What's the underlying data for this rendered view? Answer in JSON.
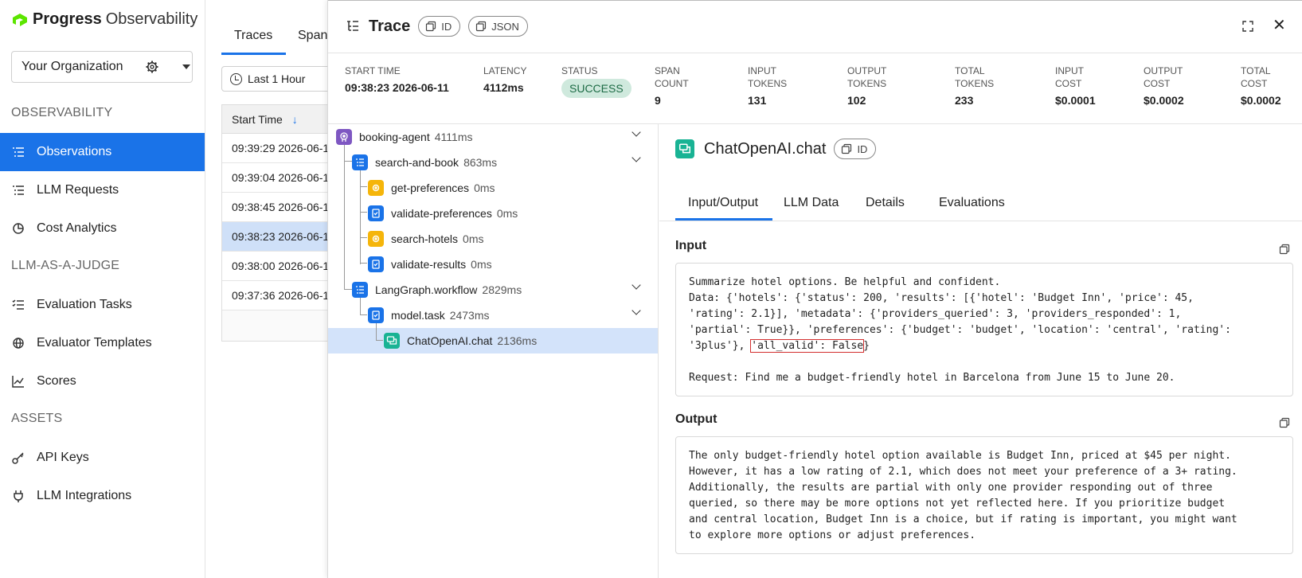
{
  "brand": {
    "name_bold": "Progress",
    "name_light": "Observability"
  },
  "org": {
    "label": "Your Organization"
  },
  "sidebar": {
    "sections": [
      "OBSERVABILITY",
      "LLM-AS-A-JUDGE",
      "ASSETS"
    ],
    "items": [
      {
        "label": "Observations",
        "icon": "list-icon"
      },
      {
        "label": "LLM Requests",
        "icon": "list-icon"
      },
      {
        "label": "Cost Analytics",
        "icon": "pie-chart-icon"
      },
      {
        "label": "Evaluation Tasks",
        "icon": "checklist-icon"
      },
      {
        "label": "Evaluator Templates",
        "icon": "globe-icon"
      },
      {
        "label": "Scores",
        "icon": "line-chart-icon"
      },
      {
        "label": "API Keys",
        "icon": "key-icon"
      },
      {
        "label": "LLM Integrations",
        "icon": "plug-icon"
      }
    ]
  },
  "list": {
    "tabs": [
      "Traces",
      "Span"
    ],
    "time_filter": "Last 1 Hour",
    "column_header": "Start Time",
    "rows": [
      "09:39:29 2026-06-1",
      "09:39:04 2026-06-1",
      "09:38:45 2026-06-1",
      "09:38:23 2026-06-1",
      "09:38:00 2026-06-1",
      "09:37:36 2026-06-1"
    ]
  },
  "trace": {
    "title": "Trace",
    "chips": [
      "ID",
      "JSON"
    ],
    "stats": [
      {
        "label": "START TIME",
        "value": "09:38:23 2026-06-11"
      },
      {
        "label": "LATENCY",
        "value": "4112ms"
      },
      {
        "label": "STATUS",
        "value": "Success"
      },
      {
        "label_1": "SPAN",
        "label_2": "COUNT",
        "value": "9"
      },
      {
        "label_1": "INPUT",
        "label_2": "TOKENS",
        "value": "131"
      },
      {
        "label_1": "OUTPUT",
        "label_2": "TOKENS",
        "value": "102"
      },
      {
        "label_1": "TOTAL",
        "label_2": "TOKENS",
        "value": "233"
      },
      {
        "label_1": "INPUT",
        "label_2": "COST",
        "value": "$0.0001"
      },
      {
        "label_1": "OUTPUT",
        "label_2": "COST",
        "value": "$0.0002"
      },
      {
        "label_1": "TOTAL",
        "label_2": "COST",
        "value": "$0.0002"
      }
    ],
    "status_color": "#cfe9dd"
  },
  "tree": [
    {
      "name": "booking-agent",
      "duration": "4111ms",
      "icon": "agent-icon",
      "color": "#7e57c2"
    },
    {
      "name": "search-and-book",
      "duration": "863ms",
      "icon": "workflow-icon",
      "color": "#1a73e8"
    },
    {
      "name": "get-preferences",
      "duration": "0ms",
      "icon": "tool-icon",
      "color": "#f5b50a"
    },
    {
      "name": "validate-preferences",
      "duration": "0ms",
      "icon": "task-icon",
      "color": "#1a73e8"
    },
    {
      "name": "search-hotels",
      "duration": "0ms",
      "icon": "tool-icon",
      "color": "#f5b50a"
    },
    {
      "name": "validate-results",
      "duration": "0ms",
      "icon": "task-icon",
      "color": "#1a73e8"
    },
    {
      "name": "LangGraph.workflow",
      "duration": "2829ms",
      "icon": "workflow-icon",
      "color": "#1a73e8"
    },
    {
      "name": "model.task",
      "duration": "2473ms",
      "icon": "task-icon",
      "color": "#1a73e8"
    },
    {
      "name": "ChatOpenAI.chat",
      "duration": "2136ms",
      "icon": "chat-icon",
      "color": "#19b394"
    }
  ],
  "detail": {
    "title": "ChatOpenAI.chat",
    "chip": "ID",
    "tabs": [
      "Input/Output",
      "LLM Data",
      "Details",
      "Evaluations"
    ],
    "input_label": "Input",
    "input_pre": "Summarize hotel options. Be helpful and confident.\nData: {'hotels': {'status': 200, 'results': [{'hotel': 'Budget Inn', 'price': 45,\n'rating': 2.1}], 'metadata': {'providers_queried': 3, 'providers_responded': 1,\n'partial': True}}, 'preferences': {'budget': 'budget', 'location': 'central', 'rating':\n'3plus'}, ",
    "input_highlight": "'all_valid': False",
    "input_post": "}\n\nRequest: Find me a budget-friendly hotel in Barcelona from June 15 to June 20.",
    "output_label": "Output",
    "output_text": "The only budget-friendly hotel option available is Budget Inn, priced at $45 per night.\nHowever, it has a low rating of 2.1, which does not meet your preference of a 3+ rating.\nAdditionally, the results are partial with only one provider responding out of three\nqueried, so there may be more options not yet reflected here. If you prioritize budget\nand central location, Budget Inn is a choice, but if rating is important, you might want\nto explore more options or adjust preferences."
  }
}
